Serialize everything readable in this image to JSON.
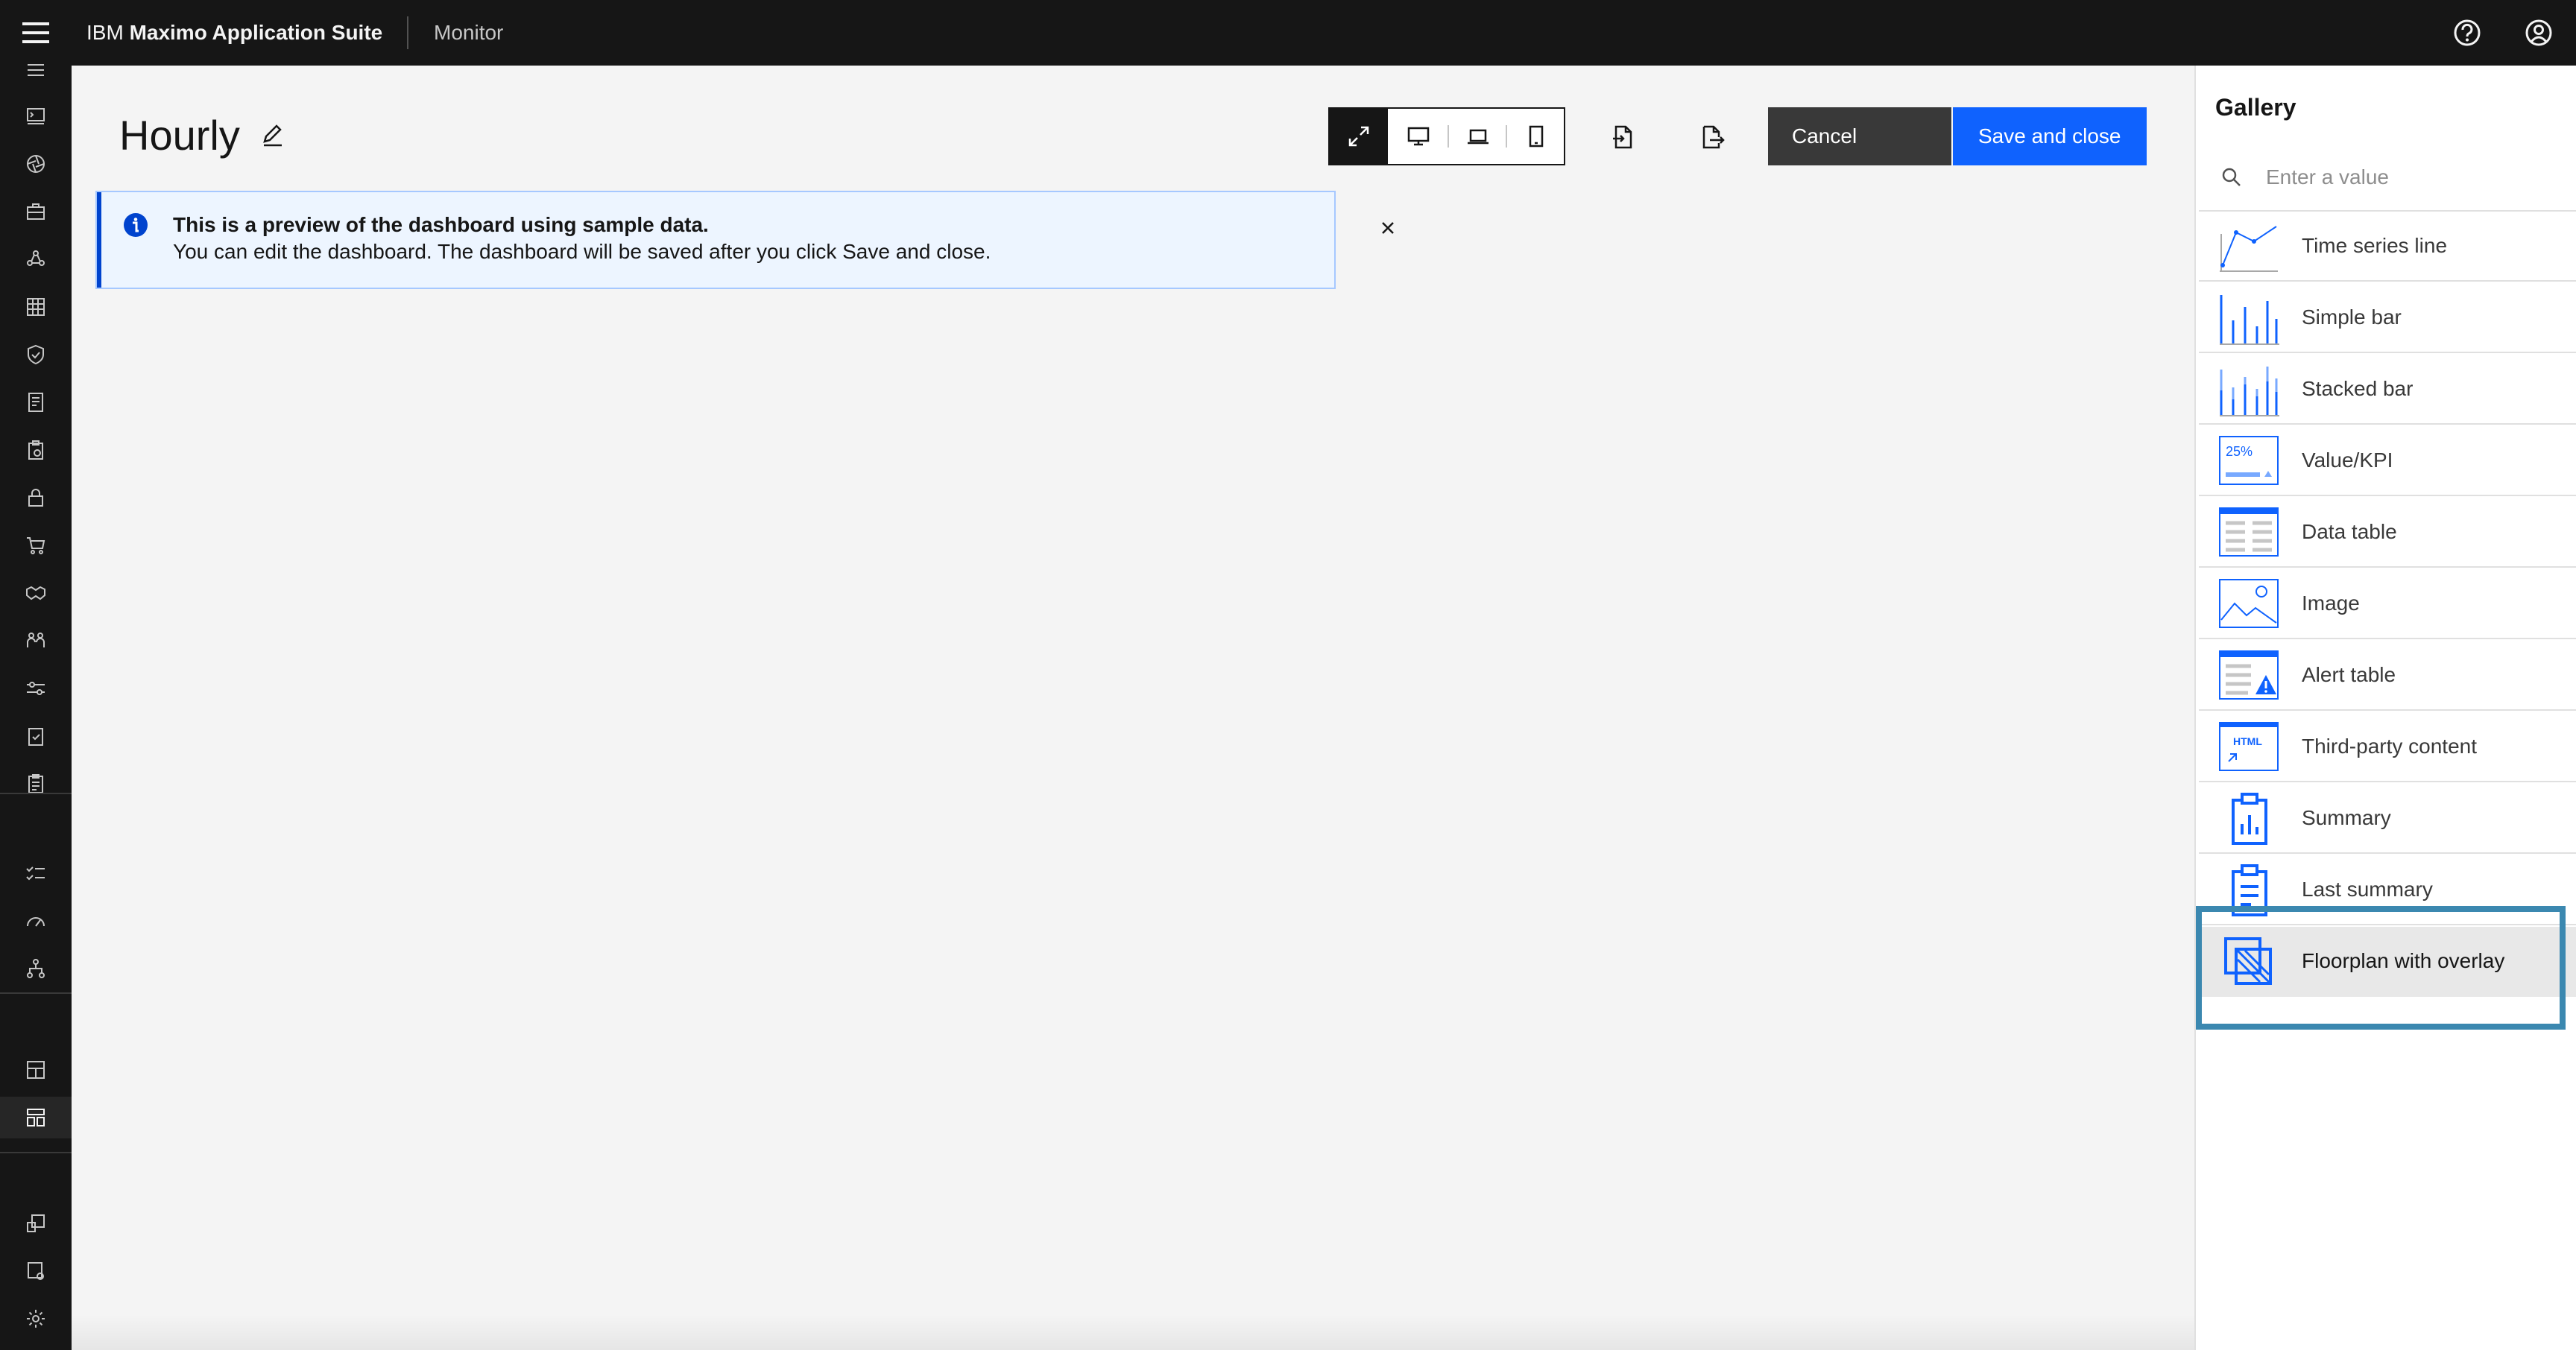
{
  "header": {
    "brand_prefix": "IBM",
    "brand_name": "Maximo Application Suite",
    "app_name": "Monitor",
    "icons": [
      "menu-icon",
      "help-icon",
      "user-avatar-icon"
    ]
  },
  "sidenav": {
    "icons": [
      "list-icon",
      "terminal-icon",
      "aperture-icon",
      "toolbox-icon",
      "flow-icon",
      "calendar-grid-icon",
      "shield-icon",
      "document-icon",
      "clipboard-icon",
      "lock-icon",
      "cart-icon",
      "handshake-icon",
      "collaborate-icon",
      "sliders-icon",
      "task-icon",
      "report-icon",
      "checklist-icon",
      "gauge-icon",
      "hierarchy-icon",
      "dashboard-grid-icon",
      "layout-icon",
      "asset-icon",
      "security-settings-icon",
      "gear-icon"
    ],
    "active": "layout-icon"
  },
  "main": {
    "title": "Hourly",
    "edit_icon": "pencil-icon",
    "view_modes": [
      "fit-to-screen-icon",
      "desktop-icon",
      "laptop-icon",
      "tablet-icon"
    ],
    "active_view": "fit-to-screen-icon",
    "tools": [
      "import-icon",
      "export-icon"
    ],
    "cancel_label": "Cancel",
    "save_label": "Save and close",
    "notification": {
      "title": "This is a preview of the dashboard using sample data.",
      "body": "You can edit the dashboard. The dashboard will be saved after you click Save and close.",
      "icon": "info-icon",
      "close_icon": "close-icon"
    }
  },
  "gallery": {
    "title": "Gallery",
    "search_placeholder": "Enter a value",
    "thumb_kpi_text": "25%",
    "thumb_html_text": "HTML",
    "items": [
      {
        "label": "Time series line"
      },
      {
        "label": "Simple bar"
      },
      {
        "label": "Stacked bar"
      },
      {
        "label": "Value/KPI"
      },
      {
        "label": "Data table"
      },
      {
        "label": "Image"
      },
      {
        "label": "Alert table"
      },
      {
        "label": "Third-party content"
      },
      {
        "label": "Summary"
      },
      {
        "label": "Last summary"
      },
      {
        "label": "Floorplan with overlay"
      }
    ],
    "highlighted": "Floorplan with overlay",
    "colors": {
      "accent": "#0f62fe",
      "highlight_border": "#3b88b0"
    }
  }
}
